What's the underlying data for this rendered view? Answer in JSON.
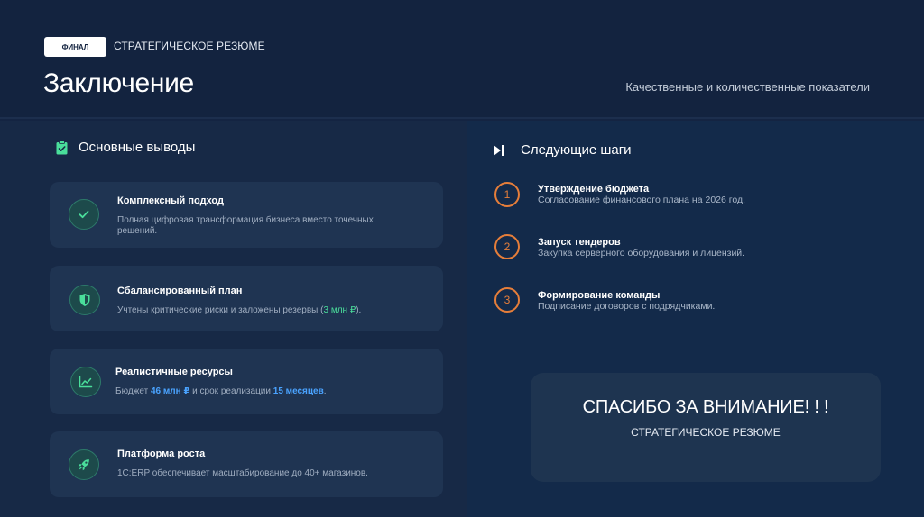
{
  "header": {
    "tag": "ФИНАЛ",
    "subtitle": "СТРАТЕГИЧЕСКОЕ РЕЗЮМЕ",
    "title": "Заключение",
    "right_caption": "Качественные и количественные показатели"
  },
  "left": {
    "heading": "Основные выводы",
    "heading_icon": "clipboard-check-icon",
    "cards": [
      {
        "icon": "check-icon",
        "title": "Комплексный подход",
        "desc_line1": "Полная цифровая трансформация бизнеса вместо точечных",
        "desc_line2": "решений."
      },
      {
        "icon": "shield-icon",
        "title": "Сбалансированный план",
        "desc_pre": "Учтены критические риски и заложены резервы (",
        "desc_hl": "3 млн ₽",
        "desc_post": ")."
      },
      {
        "icon": "chart-line-icon",
        "title": "Реалистичные ресурсы",
        "desc_pre": "Бюджет ",
        "desc_hl1": "46 млн ₽",
        "desc_mid": " и срок реализации ",
        "desc_hl2": "15 месяцев",
        "desc_post": "."
      },
      {
        "icon": "rocket-icon",
        "title": "Платформа роста",
        "desc": "1С:ERP обеспечивает масштабирование до 40+ магазинов."
      }
    ]
  },
  "right": {
    "heading": "Следующие шаги",
    "heading_icon": "play-next-icon",
    "steps": [
      {
        "num": "1",
        "title": "Утверждение бюджета",
        "desc": "Согласование финансового плана на 2026 год."
      },
      {
        "num": "2",
        "title": "Запуск тендеров",
        "desc": "Закупка серверного оборудования и лицензий."
      },
      {
        "num": "3",
        "title": "Формирование команды",
        "desc": "Подписание договоров с подрядчиками."
      }
    ],
    "thanks_title": "СПАСИБО ЗА ВНИМАНИЕ! ! !",
    "thanks_sub": "СТРАТЕГИЧЕСКОЕ РЕЗЮМЕ"
  },
  "colors": {
    "accent_green": "#4ade9b",
    "accent_blue": "#4aa3ff",
    "accent_orange": "#e67e3a",
    "background": "#142442"
  }
}
